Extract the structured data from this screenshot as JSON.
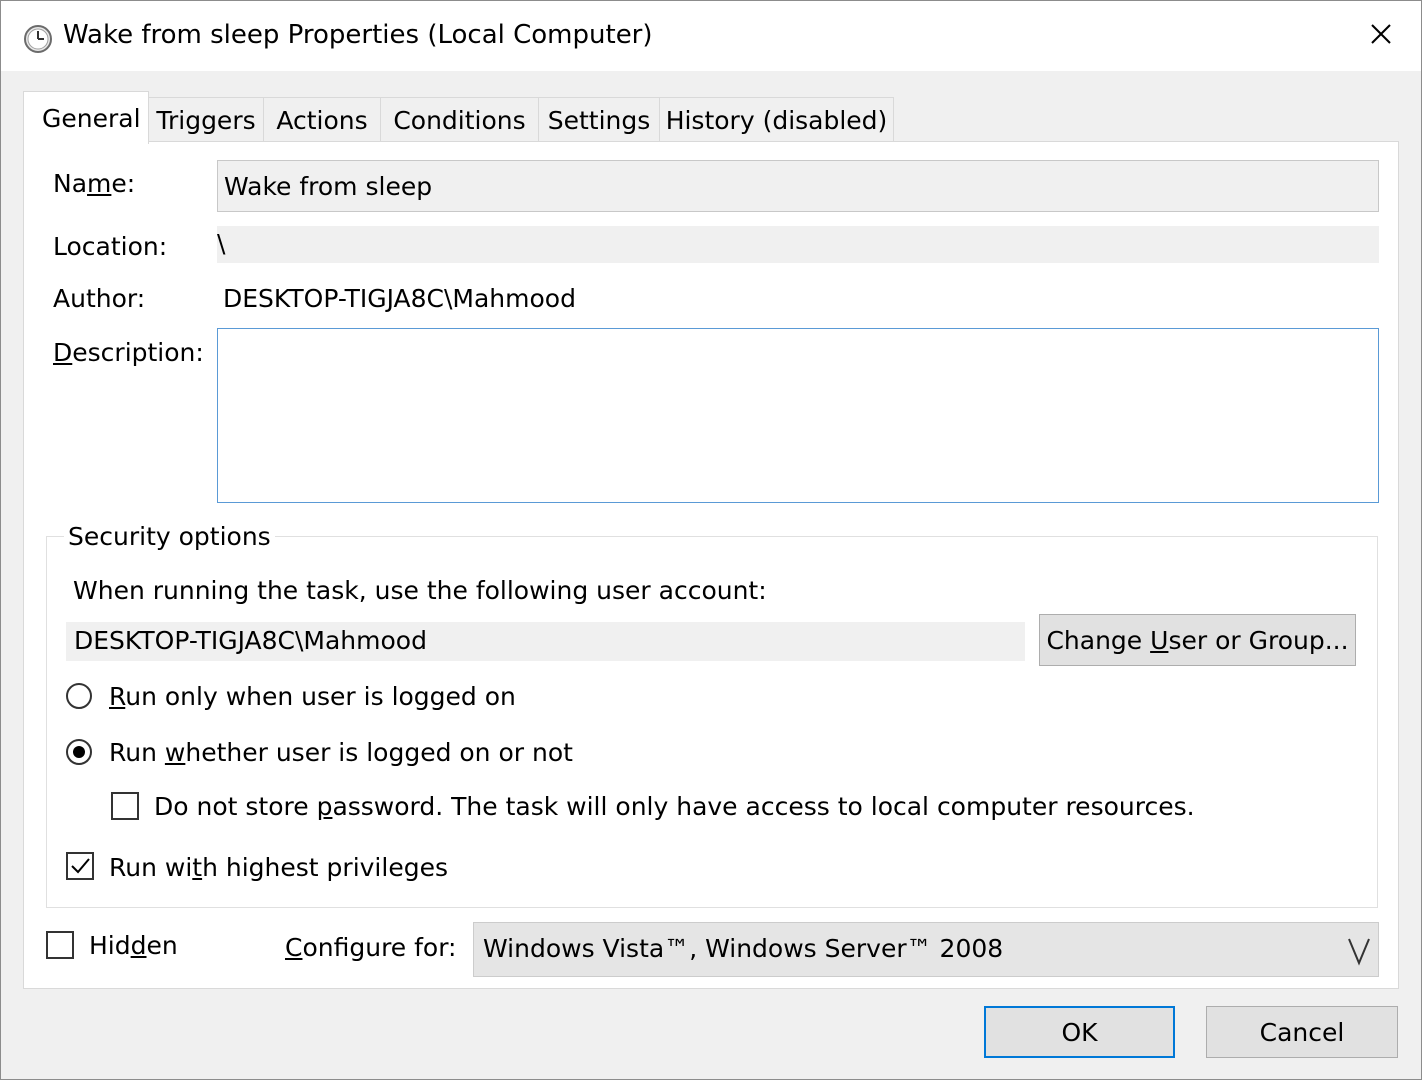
{
  "window": {
    "title": "Wake from sleep Properties (Local Computer)",
    "close_icon": "close-icon",
    "app_icon": "task-scheduler-clock-icon"
  },
  "tabs": [
    {
      "label": "General",
      "active": true
    },
    {
      "label": "Triggers",
      "active": false
    },
    {
      "label": "Actions",
      "active": false
    },
    {
      "label": "Conditions",
      "active": false
    },
    {
      "label": "Settings",
      "active": false
    },
    {
      "label": "History (disabled)",
      "active": false
    }
  ],
  "general": {
    "name_label_pre": "Na",
    "name_label_u": "m",
    "name_label_post": "e:",
    "name_value": "Wake from sleep",
    "location_label": "Location:",
    "location_value": "\\",
    "author_label": "Author:",
    "author_value": "DESKTOP-TIGJA8C\\Mahmood",
    "description_label_u": "D",
    "description_label_post": "escription:",
    "description_value": ""
  },
  "security": {
    "group_title": "Security options",
    "account_prompt": "When running the task, use the following user account:",
    "account_value": "DESKTOP-TIGJA8C\\Mahmood",
    "change_button_pre": "Change ",
    "change_button_u": "U",
    "change_button_post": "ser or Group...",
    "radio_logged_on_u": "R",
    "radio_logged_on_post": "un only when user is logged on",
    "radio_logged_on_selected": false,
    "radio_whether_pre": "Run ",
    "radio_whether_u": "w",
    "radio_whether_post": "hether user is logged on or not",
    "radio_whether_selected": true,
    "no_store_pre": "Do not store ",
    "no_store_u": "p",
    "no_store_post": "assword.  The task will only have access to local computer resources.",
    "no_store_checked": false,
    "highest_pre": "Run wi",
    "highest_u": "t",
    "highest_post": "h highest privileges",
    "highest_checked": true
  },
  "bottom": {
    "hidden_pre": "Hid",
    "hidden_u": "d",
    "hidden_post": "en",
    "hidden_checked": false,
    "configure_u": "C",
    "configure_post": "onfigure for:",
    "configure_value": "Windows Vista™, Windows Server™ 2008"
  },
  "buttons": {
    "ok": "OK",
    "cancel": "Cancel"
  },
  "colors": {
    "focus_blue": "#0078d7",
    "description_border": "#5a9ad6",
    "dialog_bg": "#f0f0f0"
  }
}
